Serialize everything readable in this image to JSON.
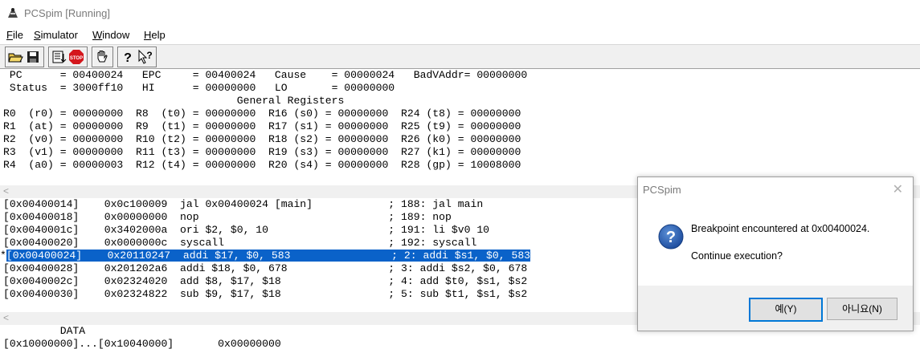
{
  "window": {
    "title": "PCSpim [Running]"
  },
  "menu": {
    "items": [
      {
        "first": "F",
        "rest": "ile"
      },
      {
        "first": "S",
        "rest": "imulator"
      },
      {
        "first": "W",
        "rest": "indow"
      },
      {
        "first": "H",
        "rest": "elp"
      }
    ]
  },
  "toolbar": {
    "buttons": [
      "open-icon",
      "save-icon",
      "log-icon",
      "stop-icon",
      "hand-icon",
      "help-icon",
      "context-help-icon"
    ],
    "stop_label": "STOP",
    "help_glyph": "?",
    "context_help_glyph": "?"
  },
  "registers": {
    "lines": [
      " PC      = 00400024   EPC     = 00400024   Cause    = 00000024   BadVAddr= 00000000",
      " Status  = 3000ff10   HI      = 00000000   LO       = 00000000",
      "                                     General Registers",
      "R0  (r0) = 00000000  R8  (t0) = 00000000  R16 (s0) = 00000000  R24 (t8) = 00000000",
      "R1  (at) = 00000000  R9  (t1) = 00000000  R17 (s1) = 00000000  R25 (t9) = 00000000",
      "R2  (v0) = 00000000  R10 (t2) = 00000000  R18 (s2) = 00000000  R26 (k0) = 00000000",
      "R3  (v1) = 00000000  R11 (t3) = 00000000  R19 (s3) = 00000000  R27 (k1) = 00000000",
      "R4  (a0) = 00000003  R12 (t4) = 00000000  R20 (s4) = 00000000  R28 (gp) = 10008000"
    ]
  },
  "text_segment": {
    "lines": [
      "[0x00400014]    0x0c100009  jal 0x00400024 [main]            ; 188: jal main",
      "[0x00400018]    0x00000000  nop                              ; 189: nop",
      "[0x0040001c]    0x3402000a  ori $2, $0, 10                   ; 191: li $v0 10",
      "[0x00400020]    0x0000000c  syscall                          ; 192: syscall",
      "[0x00400024]    0x20110247  addi $17, $0, 583                ; 2: addi $s1, $0, 583",
      "[0x00400028]    0x201202a6  addi $18, $0, 678                ; 3: addi $s2, $0, 678",
      "[0x0040002c]    0x02324020  add $8, $17, $18                 ; 4: add $t0, $s1, $s2",
      "[0x00400030]    0x02324822  sub $9, $17, $18                 ; 5: sub $t1, $s1, $s2"
    ],
    "breakpoint_marker": "*",
    "highlighted_index": 4
  },
  "data_segment": {
    "header": "         DATA",
    "first_line": "[0x10000000]...[0x10040000]       0x00000000"
  },
  "scroll_arrow": "<",
  "dialog": {
    "title": "PCSpim",
    "close_glyph": "✕",
    "icon": "question-icon",
    "icon_glyph": "?",
    "message": "Breakpoint encountered at 0x00400024.",
    "prompt": "Continue execution?",
    "yes_label": "예(Y)",
    "no_label": "아니요(N)"
  },
  "colors": {
    "selection": "#0a62c9",
    "dialog_button_focus": "#0078d7",
    "question_icon": "#1f5fb4"
  }
}
